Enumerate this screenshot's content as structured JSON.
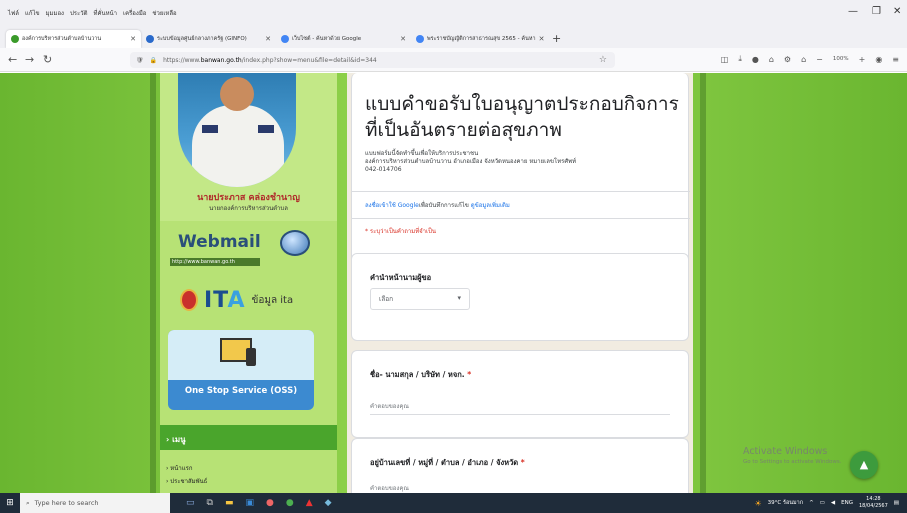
{
  "browser": {
    "menu_items": [
      "ไฟล์",
      "แก้ไข",
      "มุมมอง",
      "ประวัติ",
      "ที่คั่นหน้า",
      "เครื่องมือ",
      "ช่วยเหลือ"
    ],
    "tabs": [
      {
        "label": "องค์การบริหารส่วนตำบลบ้านวาน",
        "favicon_color": "#3a9a2a",
        "active": true
      },
      {
        "label": "ระบบข้อมูลศูนย์กลางภาครัฐ (GINFO)",
        "favicon_color": "#2a6acb",
        "active": false
      },
      {
        "label": "เว็บไซต์ - ค้นหาด้วย Google",
        "favicon_color": "#4285f4",
        "active": false
      },
      {
        "label": "พระราชบัญญัติการสาธารณสุข 2565 - ค้นหา",
        "favicon_color": "#4285f4",
        "active": false
      }
    ],
    "new_tab_icon": "plus-icon",
    "url_prefix": "https://www.",
    "url_domain": "banwan.go.th",
    "url_path": "/index.php?show=menu&file=detail&id=344",
    "zoom_level": "100%"
  },
  "sidebar": {
    "person_name": "นายประภาส คล่องชำนาญ",
    "person_title": "นายกองค์การบริหารส่วนตำบล",
    "webmail_title": "Webmail",
    "webmail_url": "http://www.banwan.go.th",
    "ita_label": "ข้อมูล ita",
    "oss_label": "One Stop Service (OSS)",
    "menu_header": "› เมนู",
    "menu_items": [
      "› หน้าแรก",
      "› ประชาสัมพันธ์"
    ]
  },
  "form": {
    "title": "แบบคำขอรับใบอนุญาตประกอบกิจการที่เป็นอันตรายต่อสุขภาพ",
    "description_line1": "แบบฟอร์มนี้จัดทำขึ้นเพื่อให้บริการประชาชน",
    "description_line2": "องค์การบริหารส่วนตำบลบ้านวาน อำเภอเมือง จังหวัดหนองคาย หมายเลขโทรศัพท์",
    "description_line3": "042-014706",
    "signin_link": "ลงชื่อเข้าใช้ Google",
    "signin_text": "เพื่อบันทึกการแก้ไข",
    "signin_more": "ดูข้อมูลเพิ่มเติม",
    "required_note": "* ระบุว่าเป็นคำถามที่จำเป็น",
    "questions": [
      {
        "label": "คำนำหน้านามผู้ขอ",
        "required": false,
        "type": "dropdown",
        "value": "เลือก"
      },
      {
        "label": "ชื่อ- นามสกุล / บริษัท / หจก.",
        "required": true,
        "type": "text",
        "placeholder": "คำตอบของคุณ"
      },
      {
        "label": "อยู่บ้านเลขที่ / หมู่ที่ / ตำบล / อำเภอ / จังหวัด",
        "required": true,
        "type": "text",
        "placeholder": "คำตอบของคุณ"
      }
    ],
    "required_mark": "*"
  },
  "overlay": {
    "activate_title": "Activate Windows",
    "activate_sub": "Go to Settings to activate Windows."
  },
  "taskbar": {
    "search_placeholder": "Type here to search",
    "weather": "39°C ร้อนมาก",
    "language": "ENG",
    "time": "14:28",
    "date": "18/04/2567"
  },
  "colors": {
    "page_green": "#8ed14a",
    "sidebar_green": "#b7e275",
    "form_bg": "#f1ece1",
    "required_red": "#d93025",
    "link_blue": "#1a73e8"
  }
}
